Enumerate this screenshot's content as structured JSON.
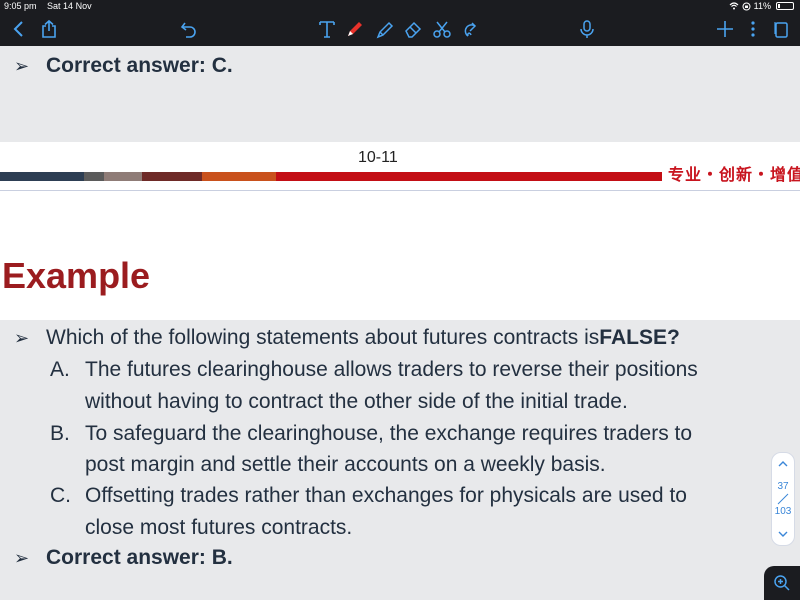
{
  "status_bar": {
    "time": "9:05 pm",
    "date": "Sat 14 Nov",
    "battery": "11%"
  },
  "toolbar": {
    "icons": [
      "back-icon",
      "share-icon",
      "undo-icon",
      "text-tool-icon",
      "pen-icon",
      "highlighter-icon",
      "eraser-icon",
      "scissors-icon",
      "lasso-icon",
      "microphone-icon",
      "add-icon",
      "more-icon",
      "pages-icon"
    ],
    "active_color": "#e8322b"
  },
  "slide1": {
    "answer": "Correct answer: C."
  },
  "footer": {
    "page_number": "10-11",
    "motto": "专业・创新・增值",
    "bar_colors": [
      "#2d3e53",
      "#5b5b5b",
      "#8f7c77",
      "#6e2a27",
      "#c9511c",
      "#c30e15"
    ]
  },
  "slide2": {
    "title": "Example",
    "question_prefix": "Which of the following statements about futures contracts is ",
    "question_emphasis": "FALSE?",
    "options": [
      {
        "letter": "A.",
        "line1": "The futures clearinghouse allows traders to reverse their positions",
        "line2": "without having to contract the other side of the initial trade."
      },
      {
        "letter": "B.",
        "line1": "To safeguard the clearinghouse, the exchange requires traders to",
        "line2": "post margin and settle their accounts on a weekly basis."
      },
      {
        "letter": "C.",
        "line1": "Offsetting trades rather than exchanges for physicals are used to",
        "line2": "close most futures contracts."
      }
    ],
    "answer": "Correct answer: B."
  },
  "pager": {
    "current": "37",
    "total": "103"
  }
}
